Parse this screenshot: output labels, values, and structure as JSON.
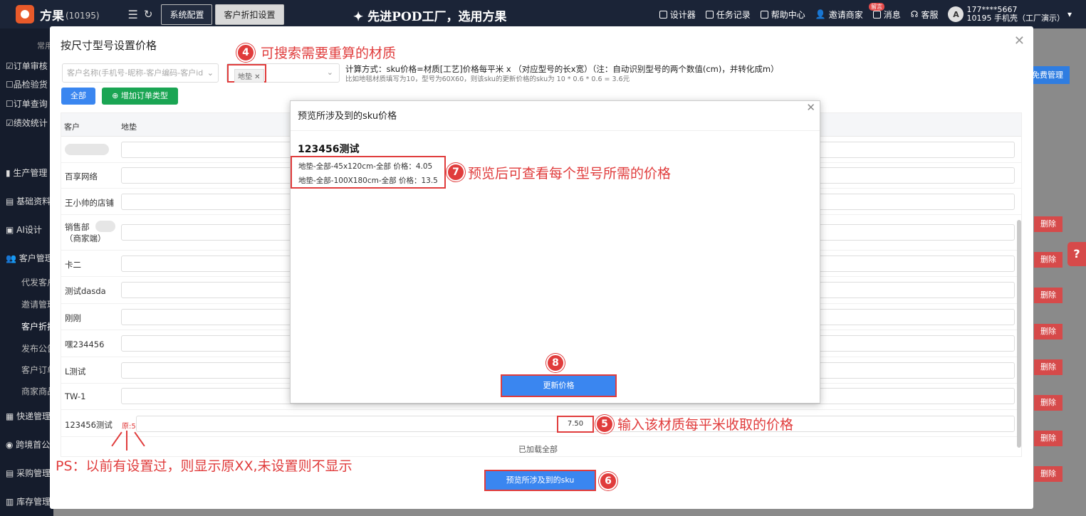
{
  "topbar": {
    "brand": "方果",
    "brand_id": "(10195)",
    "tab_system": "系统配置",
    "tab_active": "客户折扣设置",
    "slogan": "先进POD工厂，选用方果",
    "links": [
      "设计器",
      "任务记录",
      "帮助中心",
      "邀请商家",
      "消息",
      "客服"
    ],
    "badge": "留言",
    "user_phone": "177****5667",
    "user_sub": "10195 手机壳（工厂演示）",
    "avatar": "A"
  },
  "sidebar": {
    "top_label": "常用",
    "quick": [
      "订单审核",
      "品检验货",
      "订单查询",
      "绩效统计"
    ],
    "groups": [
      "生产管理",
      "基础资料",
      "AI设计",
      "客户管理"
    ],
    "subs": [
      "代发客户",
      "邀请管理",
      "客户折扣",
      "发布公告",
      "客户订单",
      "商家商品"
    ],
    "more": [
      "快递管理",
      "跨境首公",
      "采购管理",
      "库存管理"
    ]
  },
  "background": {
    "manage_button": "免费管理",
    "delete_label": "删除",
    "help_icon": "?"
  },
  "modal": {
    "title": "按尺寸型号设置价格",
    "customer_placeholder": "客户名称(手机号-昵称-客户编码-客户id",
    "material_tag": "地垫",
    "formula_line1": "计算方式：sku价格=材质[工艺]价格每平米 x （对应型号的长x宽）（注：自动识别型号的两个数值(cm)，并转化成m）",
    "formula_line2": "比如地毯材质填写为10，型号为60X60，则该sku的更新价格的sku为 10 * 0.6 * 0.6 = 3.6元",
    "btn_all": "全部",
    "btn_add": "增加订单类型",
    "col_customer": "客户",
    "col_material": "地垫",
    "rows": [
      {
        "name": ""
      },
      {
        "name": "百享网络"
      },
      {
        "name": "王小帅的店铺"
      },
      {
        "name": "销售部"
      },
      {
        "name": "（商家端）"
      },
      {
        "name": "卡二"
      },
      {
        "name": "测试dasda"
      },
      {
        "name": "刚刚"
      },
      {
        "name": "嘿234456"
      },
      {
        "name": "L测试"
      },
      {
        "name": "TW-1"
      },
      {
        "name": "123456测试"
      }
    ],
    "orig_label": "原:5",
    "input_value": "7.50",
    "loaded_all": "已加载全部",
    "btn_preview": "预览所涉及到的sku"
  },
  "preview": {
    "title": "预览所涉及到的sku价格",
    "sku_name": "123456测试",
    "items": [
      "地垫-全部-45x120cm-全部 价格：4.05",
      "地垫-全部-100X180cm-全部 价格：13.5"
    ],
    "btn_update": "更新价格"
  },
  "annotations": {
    "n4": "4",
    "t4": "可搜索需要重算的材质",
    "n5": "5",
    "t5": "输入该材质每平米收取的价格",
    "n6": "6",
    "n7": "7",
    "t7": "预览后可查看每个型号所需的价格",
    "n8": "8",
    "ps": "PS：以前有设置过，则显示原XX,未设置则不显示"
  }
}
